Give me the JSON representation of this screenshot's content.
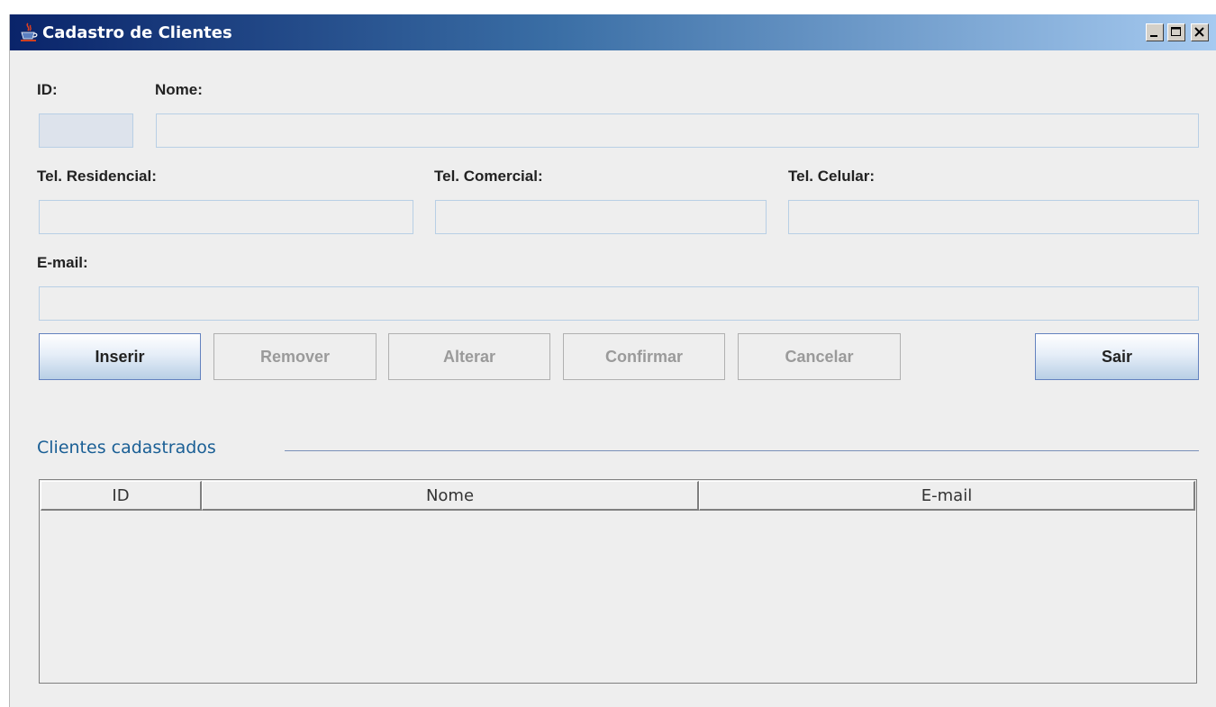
{
  "window": {
    "title": "Cadastro de Clientes",
    "controls": {
      "minimize": "minimize-icon",
      "maximize": "maximize-icon",
      "close": "close-icon"
    }
  },
  "form": {
    "id_label": "ID:",
    "nome_label": "Nome:",
    "tel_residencial_label": "Tel. Residencial:",
    "tel_comercial_label": "Tel. Comercial:",
    "tel_celular_label": "Tel. Celular:",
    "email_label": "E-mail:",
    "values": {
      "id": "",
      "nome": "",
      "tel_residencial": "",
      "tel_comercial": "",
      "tel_celular": "",
      "email": ""
    }
  },
  "buttons": {
    "inserir": "Inserir",
    "remover": "Remover",
    "alterar": "Alterar",
    "confirmar": "Confirmar",
    "cancelar": "Cancelar",
    "sair": "Sair"
  },
  "clientes": {
    "title": "Clientes cadastrados",
    "columns": [
      "ID",
      "Nome",
      "E-mail"
    ],
    "rows": []
  },
  "colors": {
    "title_bar_start": "#0a246a",
    "title_bar_end": "#a6caf0",
    "section_title": "#1a5f95",
    "field_border": "#b8cfe5"
  }
}
